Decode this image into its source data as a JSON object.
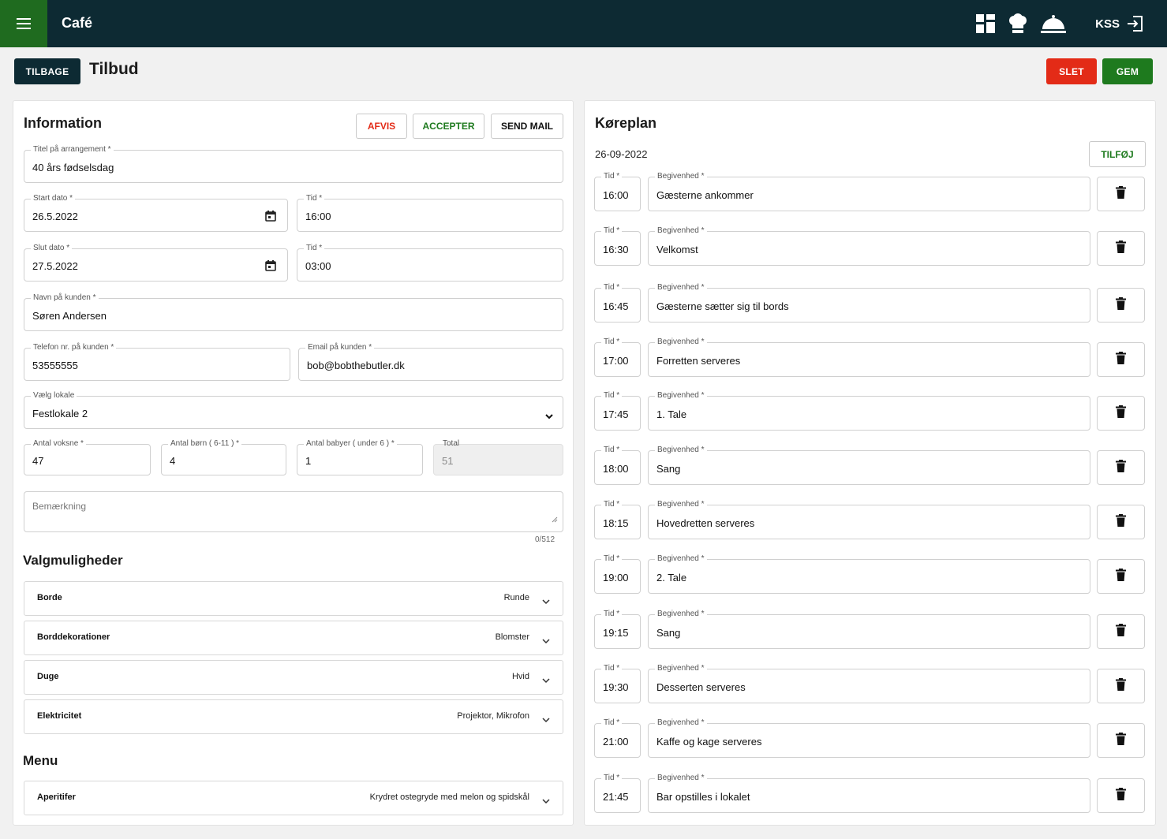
{
  "app": {
    "title": "Café",
    "user": "KSS"
  },
  "topbar_icons": [
    "dashboard-icon",
    "chef-hat-icon",
    "room-service-icon",
    "logout-icon"
  ],
  "header": {
    "back_label": "TILBAGE",
    "title": "Tilbud",
    "delete_label": "SLET",
    "save_label": "GEM"
  },
  "colors": {
    "topbar": "#0d2a33",
    "menu_accent": "#1f6b1f",
    "danger": "#e32b17",
    "success": "#1e7a1e"
  },
  "info": {
    "title": "Information",
    "reject_label": "AFVIS",
    "accept_label": "ACCEPTER",
    "send_mail_label": "SEND MAIL",
    "event_title": {
      "label": "Titel på arrangement *",
      "value": "40 års fødselsdag"
    },
    "start_date": {
      "label": "Start dato *",
      "value": "26.5.2022"
    },
    "start_time": {
      "label": "Tid *",
      "value": "16:00"
    },
    "end_date": {
      "label": "Slut dato *",
      "value": "27.5.2022"
    },
    "end_time": {
      "label": "Tid *",
      "value": "03:00"
    },
    "customer_name": {
      "label": "Navn på kunden *",
      "value": "Søren Andersen"
    },
    "customer_phone": {
      "label": "Telefon nr. på kunden *",
      "value": "53555555"
    },
    "customer_email": {
      "label": "Email på kunden *",
      "value": "bob@bobthebutler.dk"
    },
    "venue": {
      "label": "Vælg lokale",
      "value": "Festlokale 2"
    },
    "adults": {
      "label": "Antal voksne *",
      "value": "47"
    },
    "children": {
      "label": "Antal børn ( 6-11 ) *",
      "value": "4"
    },
    "babies": {
      "label": "Antal babyer ( under 6 ) *",
      "value": "1"
    },
    "total": {
      "label": "Total",
      "value": "51"
    },
    "remark": {
      "placeholder": "Bemærkning",
      "counter": "0/512"
    }
  },
  "options": {
    "title": "Valgmuligheder",
    "items": [
      {
        "label": "Borde",
        "value": "Runde"
      },
      {
        "label": "Borddekorationer",
        "value": "Blomster"
      },
      {
        "label": "Duge",
        "value": "Hvid"
      },
      {
        "label": "Elektricitet",
        "value": "Projektor, Mikrofon"
      }
    ]
  },
  "menu": {
    "title": "Menu",
    "items": [
      {
        "label": "Aperitifer",
        "value": "Krydret ostegryde med melon og spidskål"
      }
    ]
  },
  "schedule": {
    "title": "Køreplan",
    "date": "26-09-2022",
    "add_label": "TILFØJ",
    "time_label": "Tid *",
    "event_label": "Begivenhed *",
    "entries": [
      {
        "time": "16:00",
        "event": "Gæsterne ankommer"
      },
      {
        "time": "16:30",
        "event": "Velkomst"
      },
      {
        "time": "16:45",
        "event": "Gæsterne sætter sig til bords"
      },
      {
        "time": "17:00",
        "event": "Forretten serveres"
      },
      {
        "time": "17:45",
        "event": "1. Tale"
      },
      {
        "time": "18:00",
        "event": "Sang"
      },
      {
        "time": "18:15",
        "event": "Hovedretten serveres"
      },
      {
        "time": "19:00",
        "event": "2. Tale"
      },
      {
        "time": "19:15",
        "event": "Sang"
      },
      {
        "time": "19:30",
        "event": "Desserten serveres"
      },
      {
        "time": "21:00",
        "event": "Kaffe og kage serveres"
      },
      {
        "time": "21:45",
        "event": "Bar opstilles i lokalet"
      }
    ]
  }
}
